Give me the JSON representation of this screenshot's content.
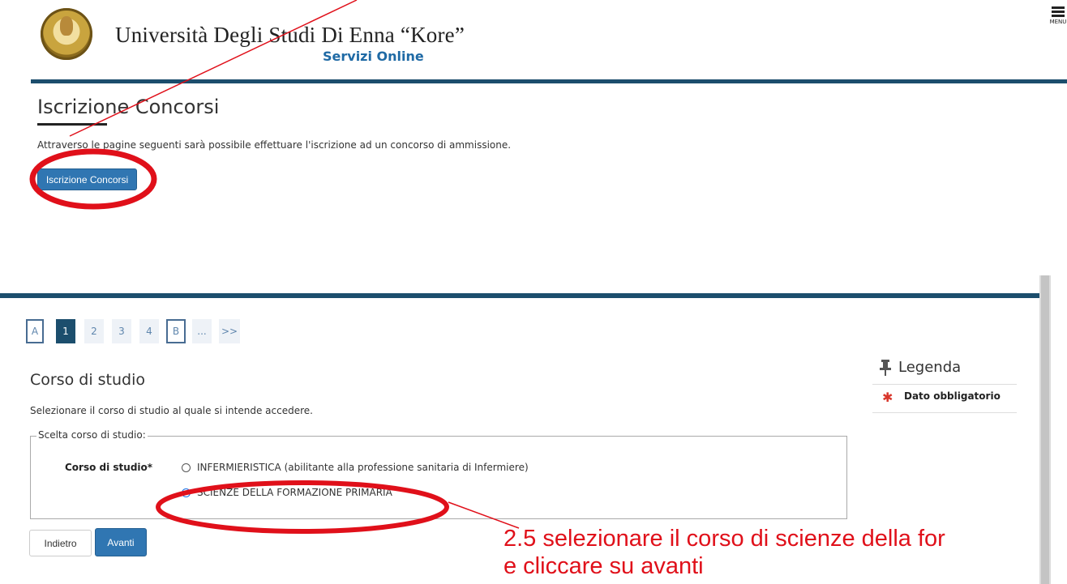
{
  "header": {
    "university_name": "Università Degli Studi Di Enna “Kore”",
    "subtitle": "Servizi Online",
    "menu_label": "MENU"
  },
  "top_section": {
    "title": "Iscrizione Concorsi",
    "intro": "Attraverso le pagine seguenti sarà possibile effettuare l'iscrizione ad un concorso di ammissione.",
    "button_label": "Iscrizione Concorsi"
  },
  "pagination": {
    "items": [
      "A",
      "1",
      "2",
      "3",
      "4",
      "B",
      "...",
      ">>"
    ],
    "active": "1"
  },
  "form": {
    "title": "Corso di studio",
    "description": "Selezionare il corso di studio al quale si intende accedere.",
    "fieldset_legend": "Scelta corso di studio:",
    "field_label": "Corso di studio*",
    "options": [
      {
        "label": "INFERMIERISTICA (abilitante alla professione sanitaria di Infermiere)",
        "selected": false
      },
      {
        "label": "SCIENZE DELLA FORMAZIONE PRIMARIA",
        "selected": true
      }
    ],
    "back_label": "Indietro",
    "next_label": "Avanti"
  },
  "legend": {
    "title": "Legenda",
    "item": "Dato obbligatorio"
  },
  "annotation": {
    "line1": "2.5 selezionare il corso di scienze della for",
    "line2": "e cliccare su avanti",
    "color": "#e0101a"
  },
  "colors": {
    "primary_button": "#3076b2",
    "header_bar": "#1c4e6d",
    "brand_blue": "#1f6aa5"
  }
}
